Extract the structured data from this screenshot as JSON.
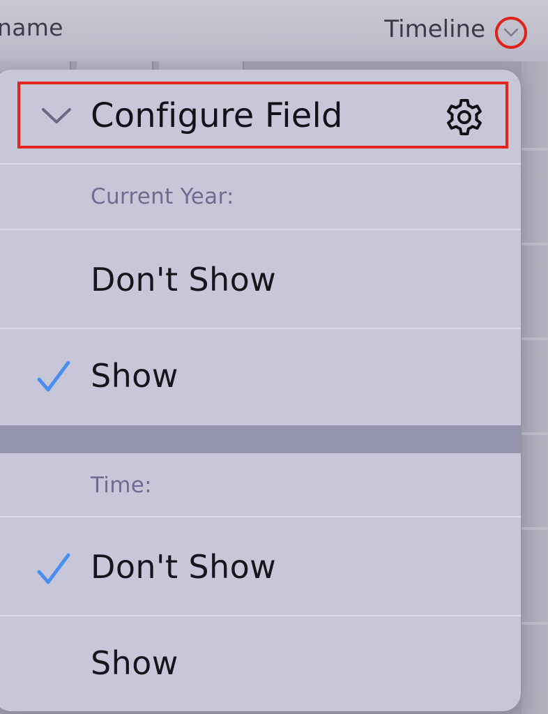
{
  "background": {
    "column_left_label": "name",
    "column_right_label": "Timeline"
  },
  "menu": {
    "header": {
      "title": "Configure Field",
      "leading_icon": "chevron-down-icon",
      "trailing_icon": "gear-icon"
    },
    "sections": [
      {
        "label": "Current Year:",
        "options": [
          {
            "label": "Don't Show",
            "checked": false
          },
          {
            "label": "Show",
            "checked": true
          }
        ]
      },
      {
        "label": "Time:",
        "options": [
          {
            "label": "Don't Show",
            "checked": true
          },
          {
            "label": "Show",
            "checked": false
          }
        ]
      }
    ]
  },
  "colors": {
    "check_accent": "#4a8ef0",
    "highlight_border": "#e3251c",
    "menu_background": "#c8c7d9"
  }
}
